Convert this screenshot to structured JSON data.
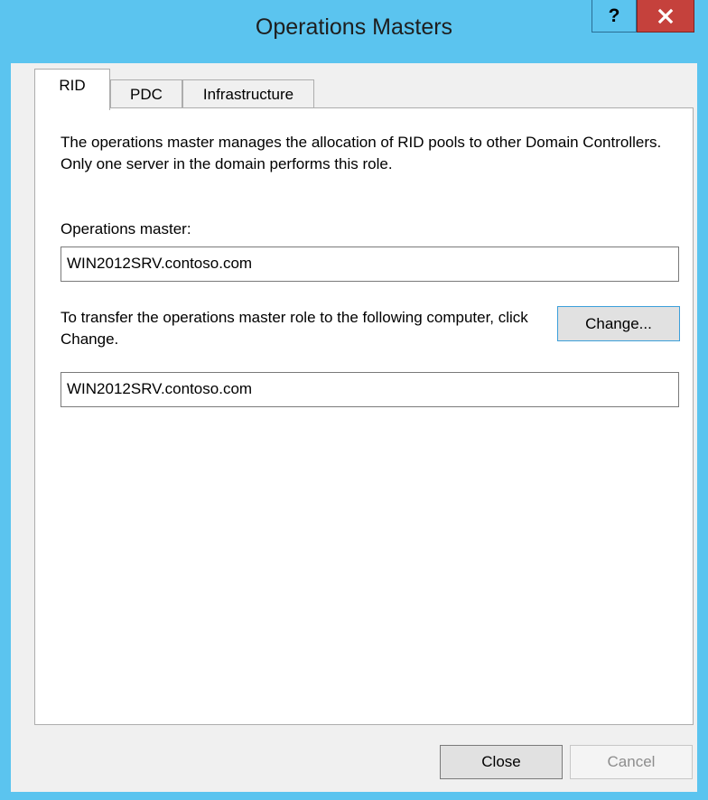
{
  "window": {
    "title": "Operations Masters",
    "help_label": "?",
    "close_icon": "close-x-icon"
  },
  "tabs": [
    {
      "label": "RID",
      "active": true
    },
    {
      "label": "PDC",
      "active": false
    },
    {
      "label": "Infrastructure",
      "active": false
    }
  ],
  "rid_panel": {
    "description": "The operations master manages the allocation of RID pools to other Domain Controllers. Only one server in the domain performs this role.",
    "operations_master_label": "Operations master:",
    "operations_master_value": "WIN2012SRV.contoso.com",
    "transfer_text": "To transfer the operations master role to the following computer, click Change.",
    "change_button_label": "Change...",
    "target_computer_value": "WIN2012SRV.contoso.com"
  },
  "footer": {
    "close_label": "Close",
    "cancel_label": "Cancel"
  },
  "colors": {
    "frame": "#5bc4ef",
    "close_button": "#c5413c",
    "focus_border": "#3c9fda"
  }
}
